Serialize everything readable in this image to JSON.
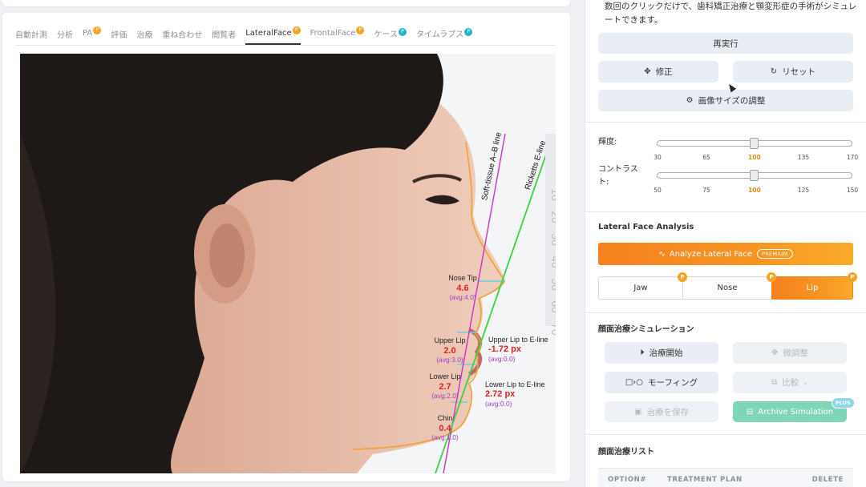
{
  "tabs": [
    {
      "label": "自動計測",
      "badge": null
    },
    {
      "label": "分析",
      "badge": null
    },
    {
      "label": "PA",
      "badge": "P"
    },
    {
      "label": "評価",
      "badge": null
    },
    {
      "label": "治療",
      "badge": null
    },
    {
      "label": "重ね合わせ",
      "badge": null
    },
    {
      "label": "閲覧者",
      "badge": null
    },
    {
      "label": "LateralFace",
      "badge": "P"
    },
    {
      "label": "FrontalFace",
      "badge": "P"
    },
    {
      "label": "ケース",
      "badge": "P"
    },
    {
      "label": "タイムラプス",
      "badge": "P"
    }
  ],
  "active_tab": "LateralFace",
  "analysis": {
    "line_ab": "Soft-tissue A–B line",
    "line_e": "Ricketts E-line",
    "ruler_numbers": [
      "10",
      "20",
      "30",
      "40",
      "50",
      "60",
      "70"
    ],
    "nose_tip": {
      "label": "Nose Tip",
      "value": "4.6",
      "avg": "(avg:4.0)"
    },
    "upper_lip": {
      "label": "Upper Lip",
      "value": "2.0",
      "avg": "(avg:3.0)"
    },
    "upper_lip_eline": {
      "label": "Upper Lip to E-line",
      "value": "-1.72 px",
      "avg": "(avg:0.0)"
    },
    "lower_lip": {
      "label": "Lower Lip",
      "value": "2.7",
      "avg": "(avg:2.0)"
    },
    "lower_lip_eline": {
      "label": "Lower Lip to E-line",
      "value": "2.72 px",
      "avg": "(avg:0.0)"
    },
    "chin": {
      "label": "Chin",
      "value": "0.4",
      "avg": "(avg:1.0)"
    }
  },
  "panel": {
    "description": "数回のクリックだけで、歯科矯正治療と顎変形症の手術がシミュレートできます。",
    "rerun_label": "再実行",
    "edit_label": "修正",
    "reset_label": "リセット",
    "resize_label": "画像サイズの調整",
    "brightness": {
      "label": "輝度:",
      "value": 100,
      "ticks": [
        "30",
        "65",
        "100",
        "135",
        "170"
      ]
    },
    "contrast": {
      "label": "コントラスト:",
      "value": 100,
      "ticks": [
        "50",
        "75",
        "100",
        "125",
        "150"
      ]
    },
    "lateral_title": "Lateral Face Analysis",
    "analyze_label": "Analyze Lateral Face",
    "premium_label": "PREMIUM",
    "segments": [
      {
        "label": "Jaw",
        "badge": "P"
      },
      {
        "label": "Nose",
        "badge": "P"
      },
      {
        "label": "Lip",
        "badge": "P"
      }
    ],
    "active_segment": "Lip",
    "sim_title": "顔面治療シミュレーション",
    "start_label": "治療開始",
    "fine_label": "微調整",
    "morph_label": "モーフィング",
    "compare_label": "比較",
    "save_label": "治療を保存",
    "archive_label": "Archive Simulation",
    "plus_label": "PLUS",
    "list_title": "顔面治療リスト",
    "table_headers": [
      "OPTION#",
      "TREATMENT PLAN",
      "DELETE"
    ]
  },
  "colors": {
    "accent_orange": "#f4811f",
    "badge_orange": "#f7a325",
    "badge_teal": "#27b5c6",
    "value_red": "#e02020",
    "avg_purple": "#a03cc8",
    "line_magenta": "#c832c8",
    "line_green": "#3cd23c",
    "archive_green": "#7fd6b6"
  }
}
